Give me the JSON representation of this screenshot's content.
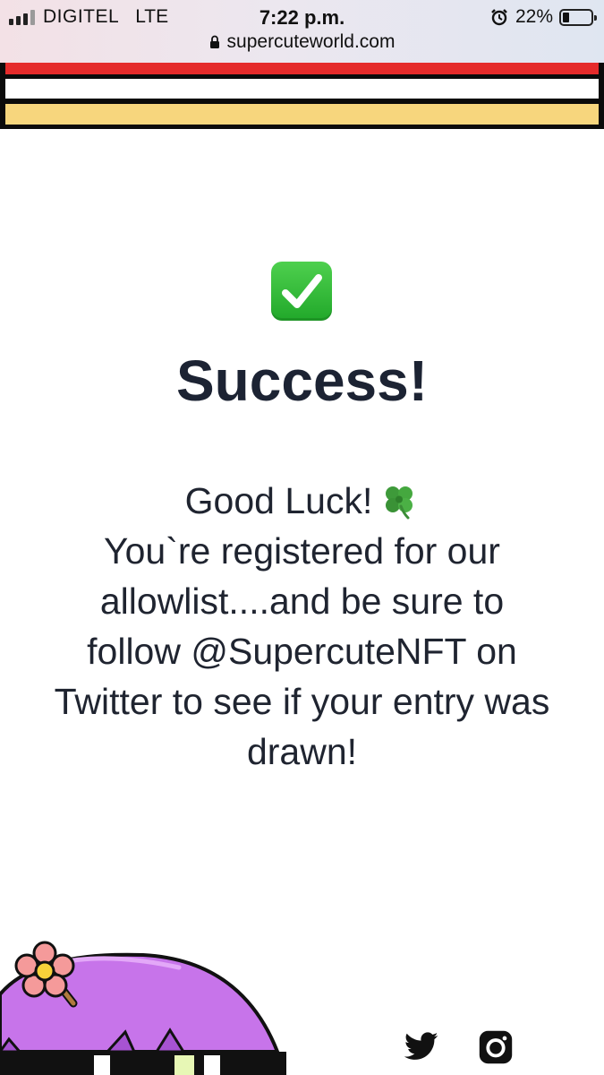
{
  "status_bar": {
    "carrier": "DIGITEL",
    "network": "LTE",
    "time": "7:22 p.m.",
    "battery_percent": "22%",
    "battery_level": 0.22,
    "url": "supercuteworld.com"
  },
  "header": {
    "stripe_colors": [
      "#e52b2b",
      "#ffffff",
      "#f7d67d"
    ]
  },
  "main": {
    "status_icon": "check-mark-button-icon",
    "title": "Success!",
    "message_lines": [
      "Good Luck!",
      "You`re registered for our",
      "allowlist....and be sure to",
      "follow @SupercuteNFT on",
      "Twitter to see if your entry was",
      "drawn!"
    ],
    "clover_icon": "four-leaf-clover-icon"
  },
  "footer": {
    "social_icons": [
      "twitter-icon",
      "instagram-icon"
    ]
  }
}
